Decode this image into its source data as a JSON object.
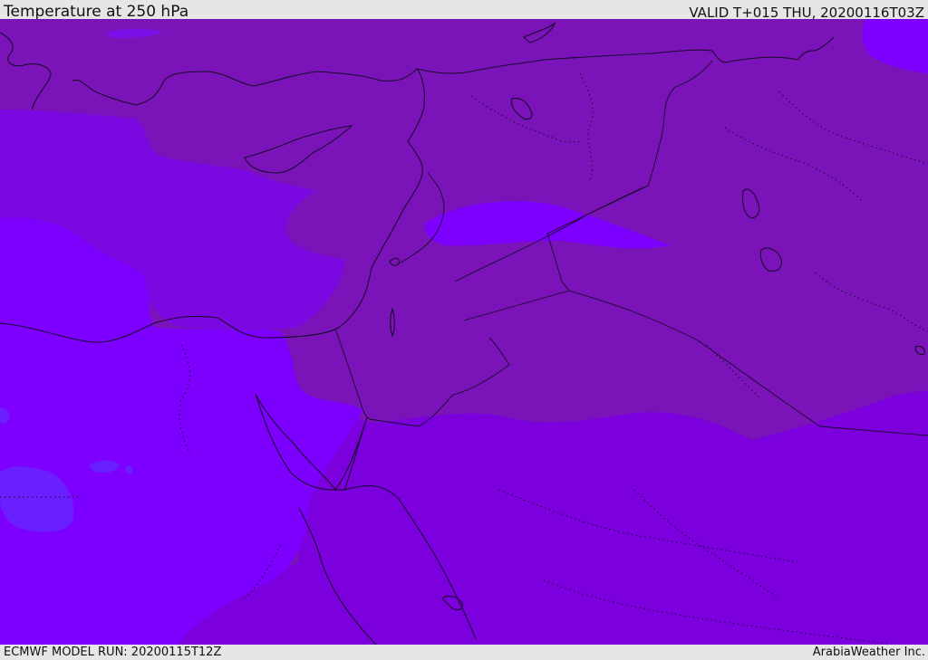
{
  "header": {
    "title": "Temperature at 250 hPa",
    "valid_time": "VALID T+015 THU, 20200116T03Z"
  },
  "footer": {
    "model_run": "ECMWF MODEL RUN: 20200115T12Z",
    "credit": "ArabiaWeather Inc."
  },
  "colors": {
    "band_warm": "#7a14b8",
    "band_mid": "#7b00dd",
    "band_cold": "#7d00ff",
    "band_coldest": "#6a1fff",
    "border_line": "#1a0a2e",
    "frame": "#e6e6e6"
  }
}
